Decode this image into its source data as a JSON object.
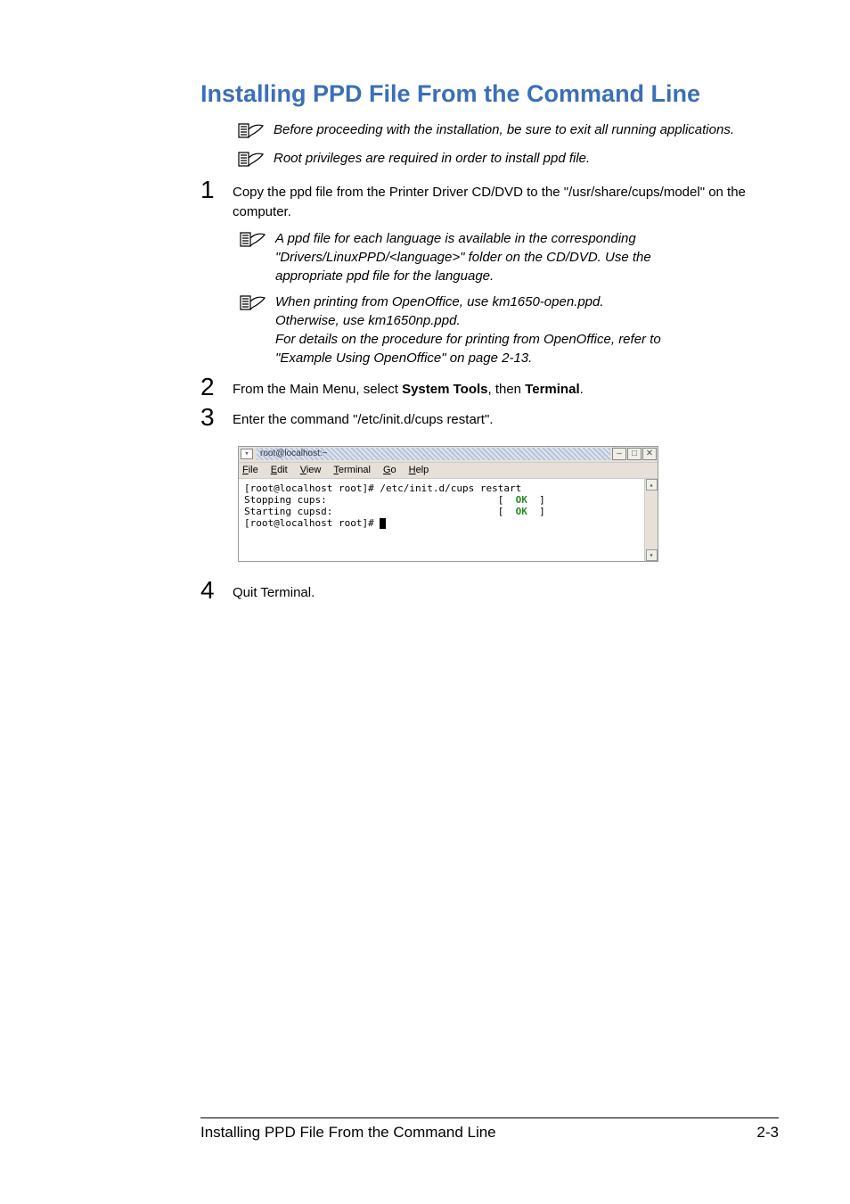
{
  "heading": "Installing PPD File From the Command Line",
  "note1": "Before proceeding with the installation, be sure to exit all running applications.",
  "note2": "Root privileges are required in order to install ppd file.",
  "step1": "Copy the ppd file from the Printer Driver CD/DVD to the \"/usr/share/cups/model\" on the computer.",
  "note3": "A ppd file for each language is available in the corresponding \"Drivers/LinuxPPD/<language>\" folder on the CD/DVD. Use the appropriate ppd file for the language.",
  "note4a": "When printing from OpenOffice, use km1650-open.ppd. Otherwise, use km1650np.ppd.",
  "note4b": "For details on the procedure for printing from OpenOffice, refer to \"Example Using OpenOffice\" on page 2-13.",
  "step2_pre": "From the Main Menu, select ",
  "step2_b1": "System Tools",
  "step2_mid": ", then ",
  "step2_b2": "Terminal",
  "step2_post": ".",
  "step3": "Enter the command \"/etc/init.d/cups restart\".",
  "step4": "Quit Terminal.",
  "nums": {
    "n1": "1",
    "n2": "2",
    "n3": "3",
    "n4": "4"
  },
  "terminal": {
    "title": "root@localhost:~",
    "menu": {
      "file_u": "F",
      "file_r": "ile",
      "edit_u": "E",
      "edit_r": "dit",
      "view_u": "V",
      "view_r": "iew",
      "term_u": "T",
      "term_r": "erminal",
      "go_u": "G",
      "go_r": "o",
      "help_u": "H",
      "help_r": "elp"
    },
    "line1a": "[root@localhost root]# /etc/init.d/cups restart",
    "line2a": "Stopping cups:",
    "line3a": "Starting cupsd:",
    "line4a": "[root@localhost root]# ",
    "ok_open": "[  ",
    "ok": "OK",
    "ok_close": "  ]",
    "btn_min": "–",
    "btn_max": "□",
    "btn_close": "✕",
    "grip": "▾",
    "arrow_up": "▴",
    "arrow_down": "▾"
  },
  "footer": {
    "title": "Installing PPD File From the Command Line",
    "page": "2-3"
  }
}
